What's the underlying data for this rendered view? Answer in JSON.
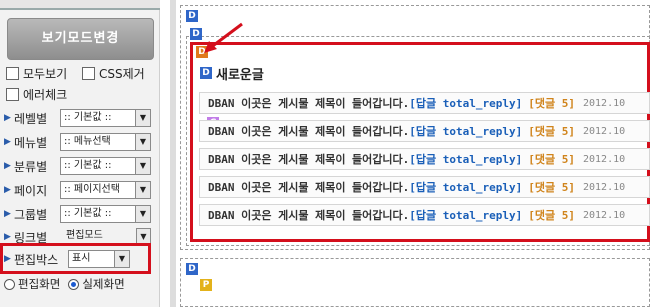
{
  "sidebar": {
    "mode_button": "보기모드변경",
    "checks": [
      {
        "label": "모두보기"
      },
      {
        "label": "CSS제거"
      },
      {
        "label": "에러체크"
      }
    ],
    "options": [
      {
        "name": "레벨별",
        "value": ":: 기본값 ::"
      },
      {
        "name": "메뉴별",
        "value": ":: 메뉴선택"
      },
      {
        "name": "분류별",
        "value": ":: 기본값 ::"
      },
      {
        "name": "페이지",
        "value": ":: 페이지선택"
      },
      {
        "name": "그룹별",
        "value": ":: 기본값 ::"
      },
      {
        "name": "링크별",
        "value": "편집모드"
      }
    ],
    "edit_box": {
      "name": "편집박스",
      "value": "표시"
    },
    "radios": [
      {
        "label": "편집화면",
        "selected": false
      },
      {
        "label": "실제화면",
        "selected": true
      }
    ]
  },
  "main": {
    "badge_d": "D",
    "badge_p": "P",
    "section_title": "새로운글",
    "post_title": "DBAN 이곳은 게시물 제목이 들어갑니다.",
    "post_reply": "[답글 total_reply]",
    "post_comment": "[댓글 5]",
    "post_date": "2012.10",
    "post_count": 5
  },
  "colors": {
    "highlight": "#d40f1c",
    "badge_blue": "#2f66c8",
    "badge_orange": "#e07a1c",
    "badge_purple": "#c27ee8"
  }
}
